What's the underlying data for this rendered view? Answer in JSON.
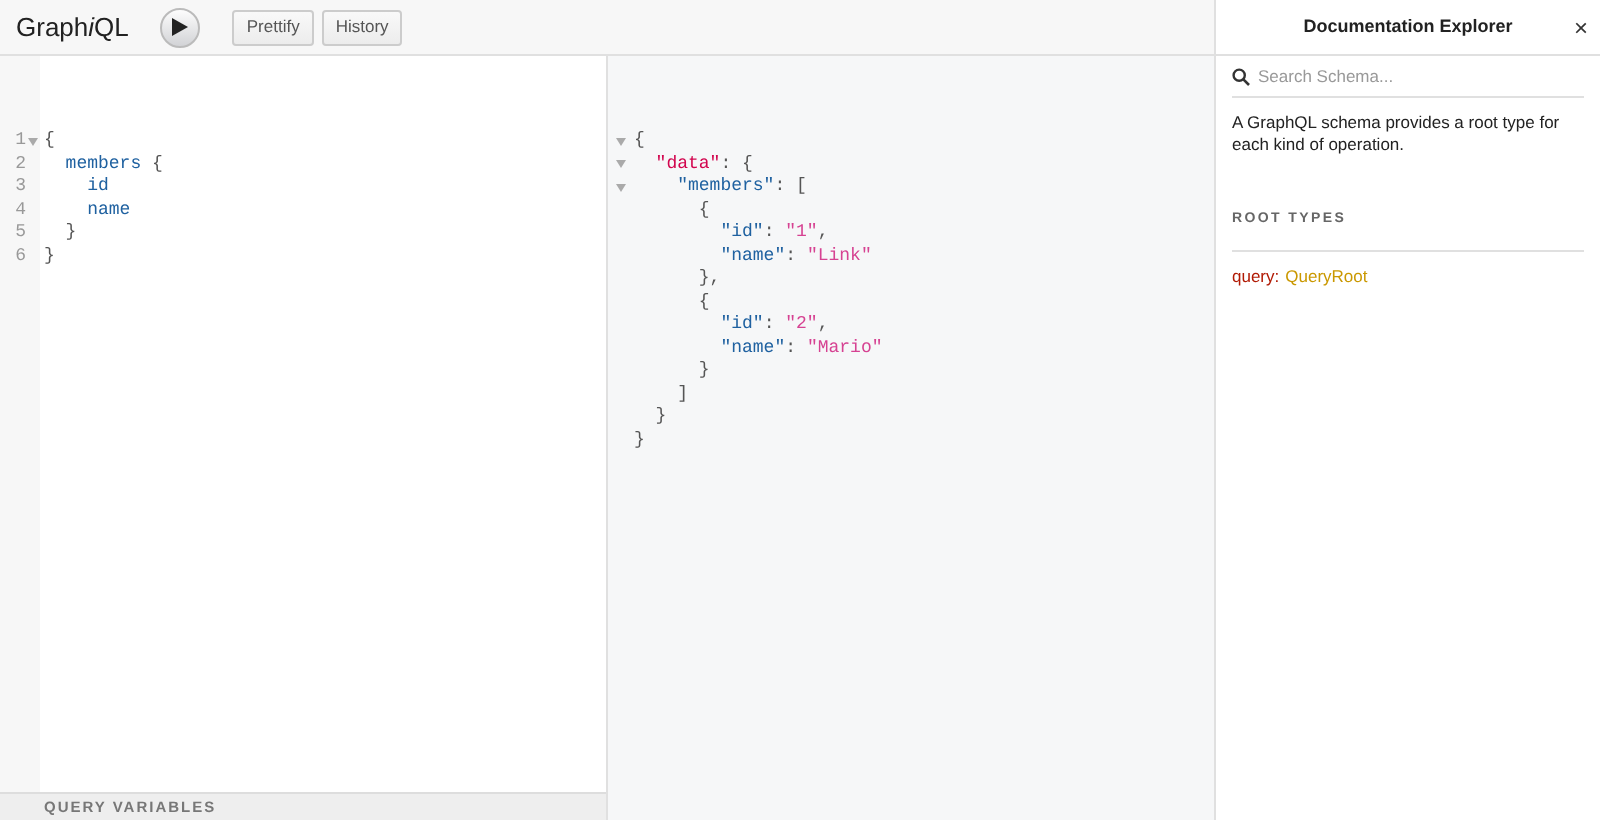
{
  "toolbar": {
    "logo": [
      {
        "text": "Graph",
        "italic": false
      },
      {
        "text": "i",
        "italic": true
      },
      {
        "text": "QL",
        "italic": false
      }
    ],
    "buttons": [
      {
        "label": "Prettify"
      },
      {
        "label": "History"
      }
    ]
  },
  "query_editor": {
    "lines": [
      {
        "number": "1",
        "foldable": true,
        "tokens": [
          {
            "kind": "punct",
            "text": "{"
          }
        ]
      },
      {
        "number": "2",
        "foldable": false,
        "tokens": [
          {
            "kind": "field",
            "text": "  members"
          },
          {
            "kind": "punct",
            "text": " {"
          }
        ]
      },
      {
        "number": "3",
        "foldable": false,
        "tokens": [
          {
            "kind": "field",
            "text": "    id"
          }
        ]
      },
      {
        "number": "4",
        "foldable": false,
        "tokens": [
          {
            "kind": "field",
            "text": "    name"
          }
        ]
      },
      {
        "number": "5",
        "foldable": false,
        "tokens": [
          {
            "kind": "punct",
            "text": "  }"
          }
        ]
      },
      {
        "number": "6",
        "foldable": false,
        "tokens": [
          {
            "kind": "punct",
            "text": "}"
          }
        ]
      }
    ],
    "variables_title": "QUERY VARIABLES"
  },
  "result": {
    "lines": [
      {
        "foldable": true,
        "tokens": [
          {
            "kind": "punct",
            "text": "{"
          }
        ]
      },
      {
        "foldable": true,
        "tokens": [
          {
            "kind": "key",
            "text": "  \"data\""
          },
          {
            "kind": "punct",
            "text": ": {"
          }
        ]
      },
      {
        "foldable": true,
        "tokens": [
          {
            "kind": "field",
            "text": "    \"members\""
          },
          {
            "kind": "punct",
            "text": ": ["
          }
        ]
      },
      {
        "foldable": false,
        "tokens": [
          {
            "kind": "punct",
            "text": "      {"
          }
        ]
      },
      {
        "foldable": false,
        "tokens": [
          {
            "kind": "field",
            "text": "        \"id\""
          },
          {
            "kind": "punct",
            "text": ": "
          },
          {
            "kind": "string",
            "text": "\"1\""
          },
          {
            "kind": "punct",
            "text": ","
          }
        ]
      },
      {
        "foldable": false,
        "tokens": [
          {
            "kind": "field",
            "text": "        \"name\""
          },
          {
            "kind": "punct",
            "text": ": "
          },
          {
            "kind": "string",
            "text": "\"Link\""
          }
        ]
      },
      {
        "foldable": false,
        "tokens": [
          {
            "kind": "punct",
            "text": "      },"
          }
        ]
      },
      {
        "foldable": false,
        "tokens": [
          {
            "kind": "punct",
            "text": "      {"
          }
        ]
      },
      {
        "foldable": false,
        "tokens": [
          {
            "kind": "field",
            "text": "        \"id\""
          },
          {
            "kind": "punct",
            "text": ": "
          },
          {
            "kind": "string",
            "text": "\"2\""
          },
          {
            "kind": "punct",
            "text": ","
          }
        ]
      },
      {
        "foldable": false,
        "tokens": [
          {
            "kind": "field",
            "text": "        \"name\""
          },
          {
            "kind": "punct",
            "text": ": "
          },
          {
            "kind": "string",
            "text": "\"Mario\""
          }
        ]
      },
      {
        "foldable": false,
        "tokens": [
          {
            "kind": "punct",
            "text": "      }"
          }
        ]
      },
      {
        "foldable": false,
        "tokens": [
          {
            "kind": "punct",
            "text": "    ]"
          }
        ]
      },
      {
        "foldable": false,
        "tokens": [
          {
            "kind": "punct",
            "text": "  }"
          }
        ]
      },
      {
        "foldable": false,
        "tokens": [
          {
            "kind": "punct",
            "text": "}"
          }
        ]
      }
    ]
  },
  "docs": {
    "title": "Documentation Explorer",
    "close": "×",
    "search": {
      "placeholder": "Search Schema..."
    },
    "description": "A GraphQL schema provides a root type for each kind of operation.",
    "section_title": "ROOT TYPES",
    "root_types": [
      {
        "name": "query:",
        "type": "QueryRoot"
      }
    ]
  }
}
